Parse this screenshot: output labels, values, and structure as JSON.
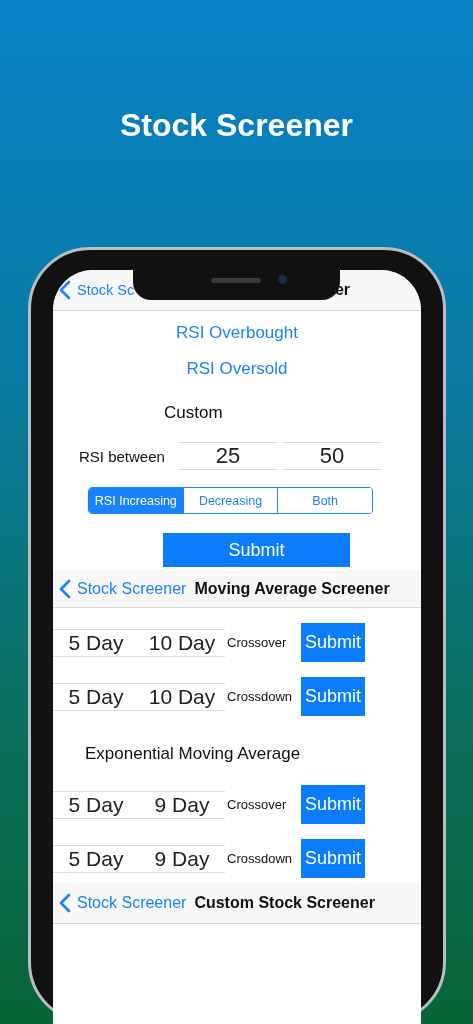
{
  "headline": "Stock Screener",
  "rsi_screen": {
    "nav": {
      "back_label": "Stock Sc",
      "title": "er"
    },
    "presets": [
      "RSI Overbought",
      "RSI Oversold"
    ],
    "custom_heading": "Custom",
    "range_label": "RSI between",
    "range_from": "25",
    "range_to": "50",
    "segments": [
      {
        "label": "RSI Increasing",
        "selected": true
      },
      {
        "label": "Decreasing",
        "selected": false
      },
      {
        "label": "Both",
        "selected": false
      }
    ],
    "submit": "Submit"
  },
  "ma_screen": {
    "nav": {
      "back_label": "Stock Screener",
      "title": "Moving Average Screener"
    },
    "rows": [
      {
        "short": "5 Day",
        "long": "10 Day",
        "signal": "Crossover",
        "submit": "Submit"
      },
      {
        "short": "5 Day",
        "long": "10 Day",
        "signal": "Crossdown",
        "submit": "Submit"
      }
    ],
    "ema_heading": "Exponential Moving Average",
    "ema_rows": [
      {
        "short": "5 Day",
        "long": "9 Day",
        "signal": "Crossover",
        "submit": "Submit"
      },
      {
        "short": "5 Day",
        "long": "9 Day",
        "signal": "Crossdown",
        "submit": "Submit"
      }
    ]
  },
  "custom_screen": {
    "nav": {
      "back_label": "Stock Screener",
      "title": "Custom Stock Screener"
    }
  }
}
